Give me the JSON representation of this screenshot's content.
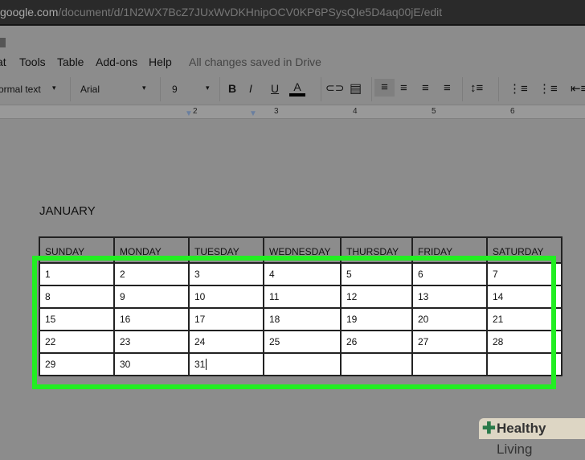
{
  "url": {
    "domain": "google.com",
    "path": "/document/d/1N2WX7BcZ7JUxWvDKHnipOCV0KP6PSysQIe5D4aq00jE/edit"
  },
  "menu": [
    "at",
    "Tools",
    "Table",
    "Add-ons",
    "Help"
  ],
  "status": "All changes saved in Drive",
  "toolbar": {
    "style": "ormal text",
    "font": "Arial",
    "size": "9",
    "bold": "B",
    "italic": "I",
    "underline": "U",
    "color": "A"
  },
  "ruler": [
    "2",
    "3",
    "4",
    "5",
    "6"
  ],
  "doc": {
    "title": "JANUARY",
    "headers": [
      "SUNDAY",
      "MONDAY",
      "TUESDAY",
      "WEDNESDAY",
      "THURSDAY",
      "FRIDAY",
      "SATURDAY"
    ],
    "rows": [
      [
        "1",
        "2",
        "3",
        "4",
        "5",
        "6",
        "7"
      ],
      [
        "8",
        "9",
        "10",
        "11",
        "12",
        "13",
        "14"
      ],
      [
        "15",
        "16",
        "17",
        "18",
        "19",
        "20",
        "21"
      ],
      [
        "22",
        "23",
        "24",
        "25",
        "26",
        "27",
        "28"
      ],
      [
        "29",
        "30",
        "31",
        "",
        "",
        "",
        ""
      ]
    ]
  },
  "watermark": {
    "bold": "Healthy",
    "light": "Living"
  },
  "colors": {
    "highlight": "#22ee22"
  }
}
